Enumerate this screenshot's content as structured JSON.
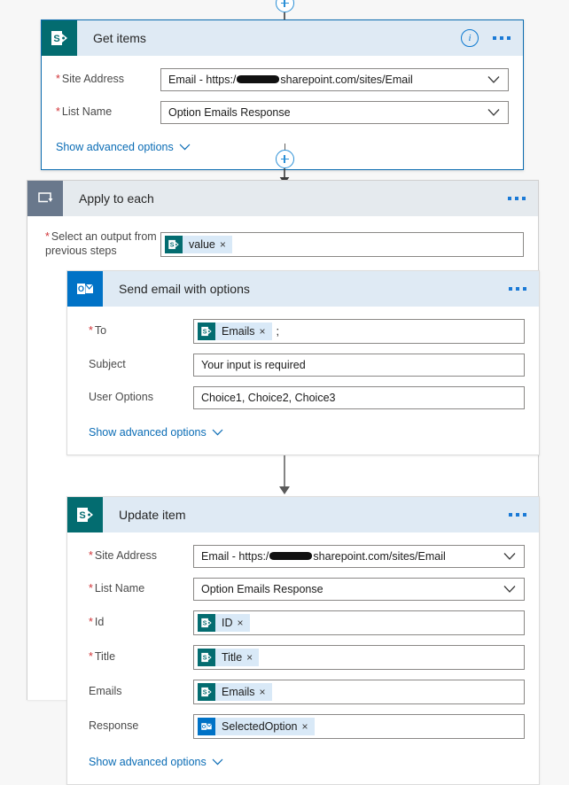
{
  "flow": {
    "top_connector": {
      "icon": "plus-circle-icon",
      "arrow": "down-arrow-icon"
    },
    "steps": [
      {
        "id": "get_items",
        "title": "Get items",
        "connector_icon": "sharepoint-icon",
        "has_info_button": true,
        "info_label": "i",
        "menu_label": "•••",
        "advanced_label": "Show advanced options",
        "fields": [
          {
            "label": "Site Address",
            "required": true,
            "type": "dropdown",
            "value_prefix": "Email - https:/",
            "redacted": true,
            "value_suffix": "sharepoint.com/sites/Email"
          },
          {
            "label": "List Name",
            "required": true,
            "type": "dropdown",
            "value": "Option Emails Response"
          }
        ]
      },
      {
        "id": "apply_to_each",
        "title": "Apply to each",
        "connector_icon": "loop-icon",
        "menu_label": "•••",
        "fields": [
          {
            "label": "Select an output from previous steps",
            "required": true,
            "type": "token",
            "tokens": [
              {
                "text": "value",
                "icon": "sharepoint-icon",
                "remove": "×"
              }
            ]
          }
        ]
      },
      {
        "id": "send_email_with_options",
        "title": "Send email with options",
        "connector_icon": "outlook-icon",
        "menu_label": "•••",
        "advanced_label": "Show advanced options",
        "fields": [
          {
            "label": "To",
            "required": true,
            "type": "token",
            "tokens": [
              {
                "text": "Emails",
                "icon": "sharepoint-icon",
                "remove": "×"
              }
            ],
            "trailing_text": ";"
          },
          {
            "label": "Subject",
            "required": false,
            "type": "text",
            "value": "Your input is required"
          },
          {
            "label": "User Options",
            "required": false,
            "type": "text",
            "value": "Choice1, Choice2, Choice3"
          }
        ]
      },
      {
        "id": "update_item",
        "title": "Update item",
        "connector_icon": "sharepoint-icon",
        "menu_label": "•••",
        "advanced_label": "Show advanced options",
        "fields": [
          {
            "label": "Site Address",
            "required": true,
            "type": "dropdown",
            "value_prefix": "Email - https:/",
            "redacted": true,
            "value_suffix": "sharepoint.com/sites/Email"
          },
          {
            "label": "List Name",
            "required": true,
            "type": "dropdown",
            "value": "Option Emails Response"
          },
          {
            "label": "Id",
            "required": true,
            "type": "token",
            "tokens": [
              {
                "text": "ID",
                "icon": "sharepoint-icon",
                "remove": "×"
              }
            ]
          },
          {
            "label": "Title",
            "required": true,
            "type": "token",
            "tokens": [
              {
                "text": "Title",
                "icon": "sharepoint-icon",
                "remove": "×"
              }
            ]
          },
          {
            "label": "Emails",
            "required": false,
            "type": "token",
            "tokens": [
              {
                "text": "Emails",
                "icon": "sharepoint-icon",
                "remove": "×"
              }
            ]
          },
          {
            "label": "Response",
            "required": false,
            "type": "token",
            "tokens": [
              {
                "text": "SelectedOption",
                "icon": "outlook-icon",
                "remove": "×"
              }
            ]
          }
        ]
      }
    ]
  },
  "colors": {
    "accent": "#0b6cb0",
    "header_blue": "#dfeaf4",
    "header_grey": "#e5eaee",
    "sharepoint": "#036c70",
    "outlook": "#0072c6",
    "loop": "#69788c",
    "token_bg": "#d9e9f7",
    "required": "#d13438",
    "link": "#0a6cb5",
    "canvas": "#f7f7f7"
  },
  "labels": {
    "chevron_down": "chevron-down-icon",
    "advanced_chevron": "∨"
  }
}
